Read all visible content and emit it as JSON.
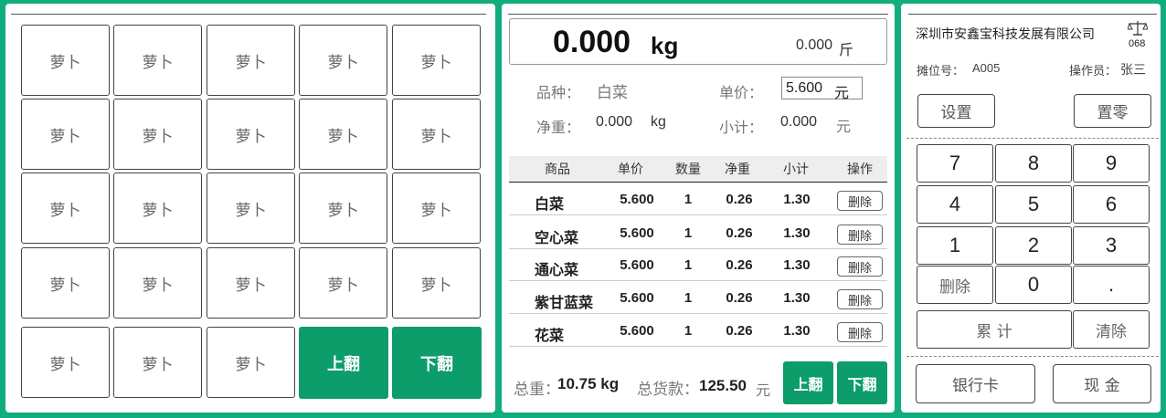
{
  "colors": {
    "background": "#12ad7f",
    "accent": "#0d9d6a"
  },
  "left": {
    "items": [
      "萝卜",
      "萝卜",
      "萝卜",
      "萝卜",
      "萝卜",
      "萝卜",
      "萝卜",
      "萝卜",
      "萝卜",
      "萝卜",
      "萝卜",
      "萝卜",
      "萝卜",
      "萝卜",
      "萝卜",
      "萝卜",
      "萝卜",
      "萝卜",
      "萝卜",
      "萝卜",
      "萝卜",
      "萝卜",
      "萝卜"
    ],
    "page_up": "上翻",
    "page_down": "下翻"
  },
  "middle": {
    "weight_kg": "0.000",
    "unit_kg": "kg",
    "weight_jin": "0.000",
    "unit_jin": "斤",
    "variety_label": "品种：",
    "variety_value": "白菜",
    "price_label": "单价：",
    "price_value": "5.600",
    "price_unit": "元",
    "net_label": "净重：",
    "net_value": "0.000",
    "net_unit": "kg",
    "subtotal_label": "小计：",
    "subtotal_value": "0.000",
    "subtotal_unit": "元",
    "headers": [
      "商品",
      "单价",
      "数量",
      "净重",
      "小计",
      "操作"
    ],
    "rows": [
      {
        "name": "白菜",
        "price": "5.600",
        "qty": "1",
        "net": "0.26",
        "subtotal": "1.30",
        "action": "删除"
      },
      {
        "name": "空心菜",
        "price": "5.600",
        "qty": "1",
        "net": "0.26",
        "subtotal": "1.30",
        "action": "删除"
      },
      {
        "name": "通心菜",
        "price": "5.600",
        "qty": "1",
        "net": "0.26",
        "subtotal": "1.30",
        "action": "删除"
      },
      {
        "name": "紫甘蓝菜",
        "price": "5.600",
        "qty": "1",
        "net": "0.26",
        "subtotal": "1.30",
        "action": "删除"
      },
      {
        "name": "花菜",
        "price": "5.600",
        "qty": "1",
        "net": "0.26",
        "subtotal": "1.30",
        "action": "删除"
      }
    ],
    "total_weight_label": "总重：",
    "total_weight_value": "10.75 kg",
    "total_amount_label": "总货款：",
    "total_amount_value": "125.50",
    "total_amount_unit": "元",
    "page_up": "上翻",
    "page_down": "下翻"
  },
  "right": {
    "company": "深圳市安鑫宝科技发展有限公司",
    "scale_number": "068",
    "stall_label": "摊位号：",
    "stall_value": "A005",
    "operator_label": "操作员：",
    "operator_value": "张三",
    "settings": "设置",
    "zero": "置零",
    "keys": [
      "7",
      "8",
      "9",
      "4",
      "5",
      "6",
      "1",
      "2",
      "3",
      "删除",
      "0",
      "."
    ],
    "accumulate": "累 计",
    "clear": "清除",
    "bank_card": "银行卡",
    "cash": "现 金"
  }
}
